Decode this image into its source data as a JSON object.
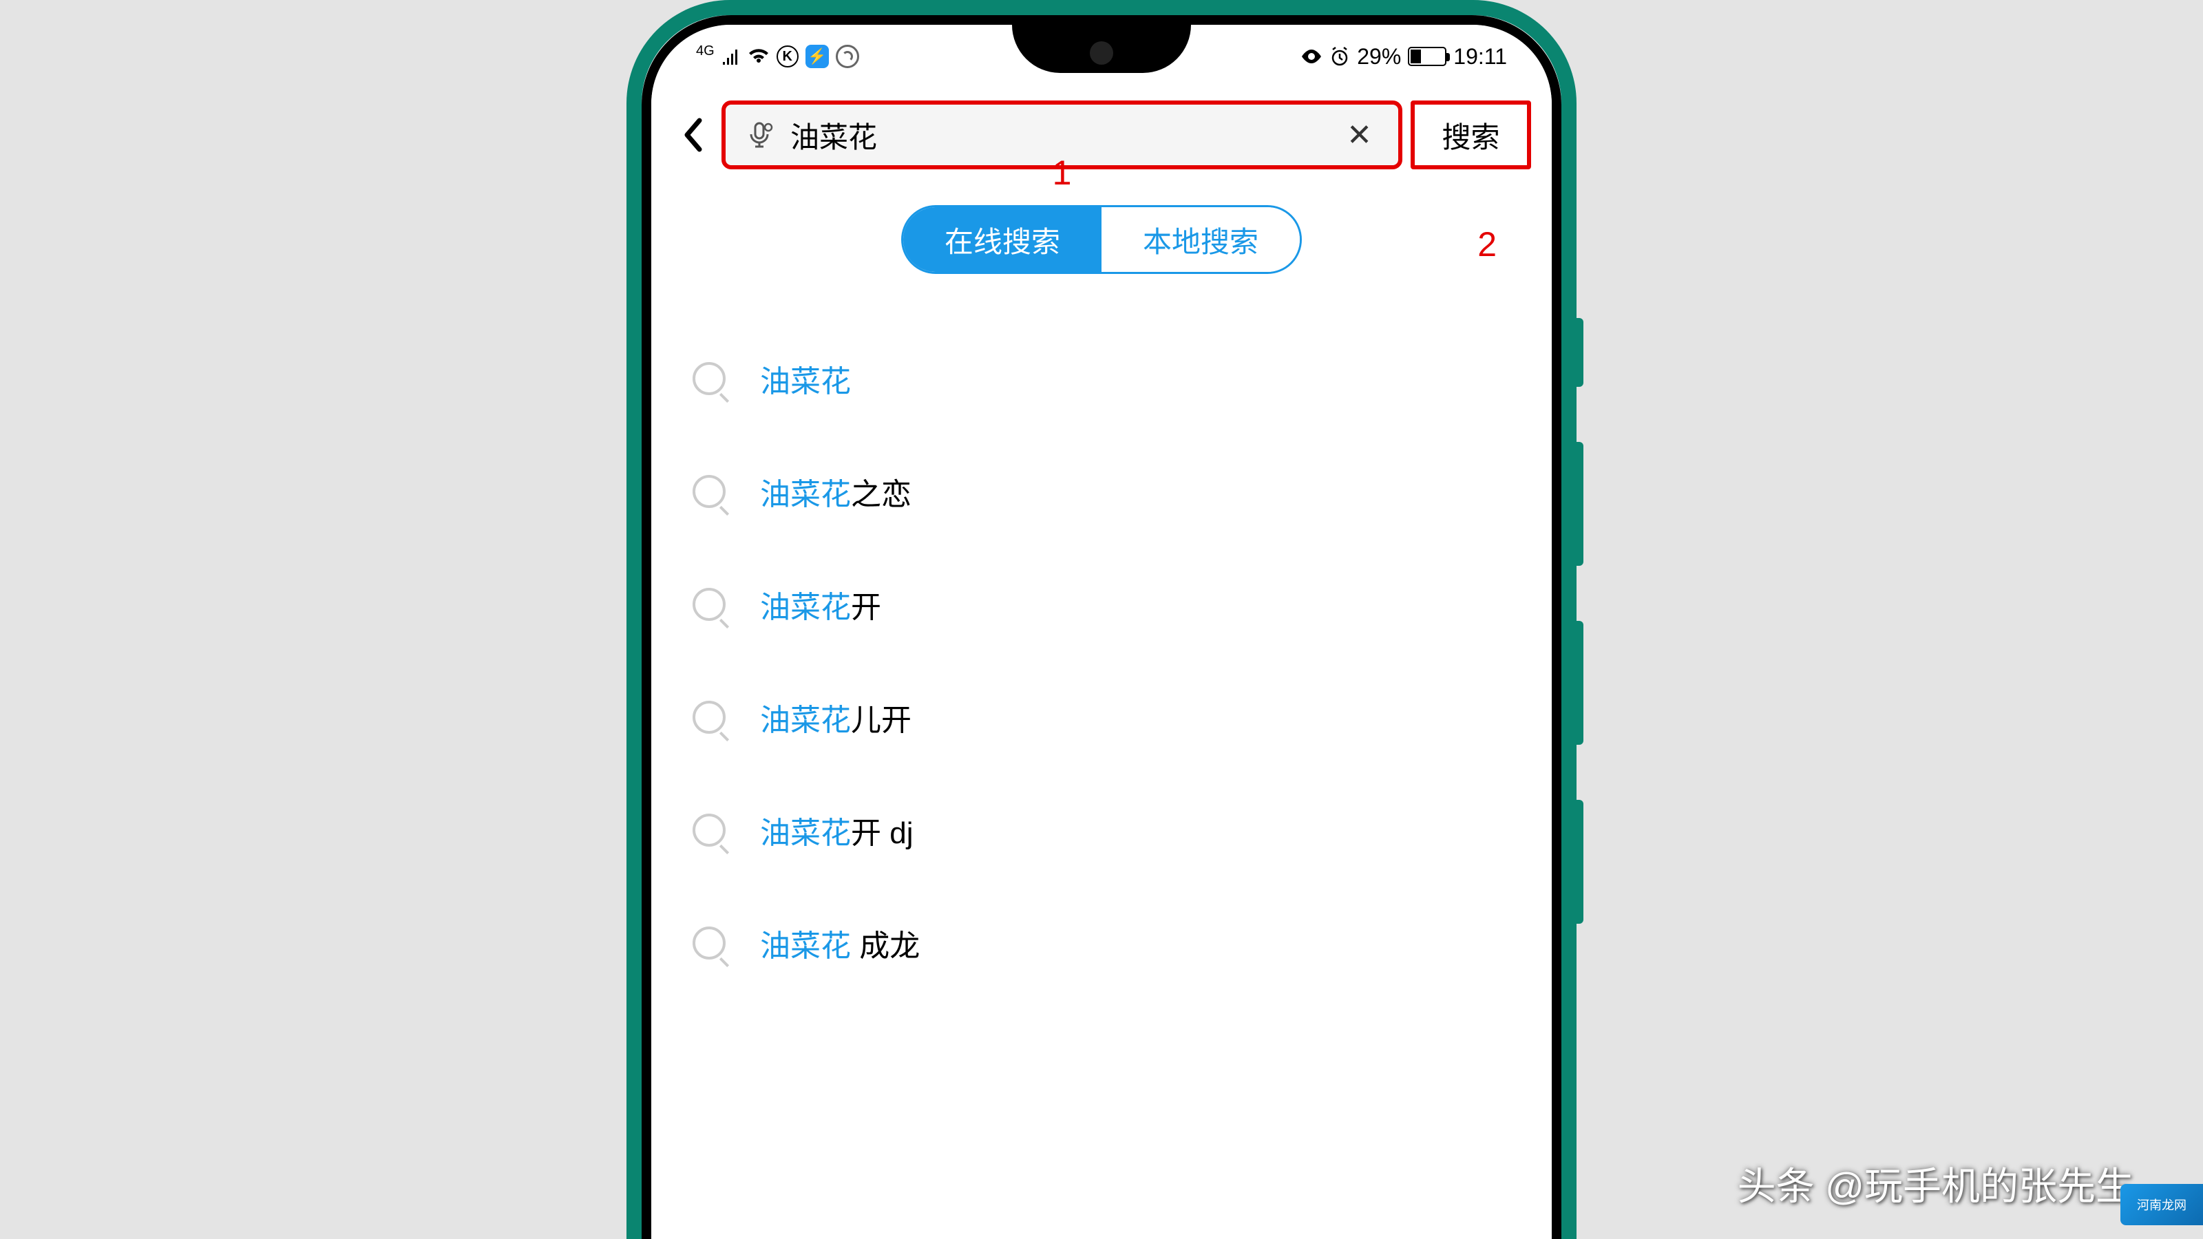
{
  "status_bar": {
    "signal_label": "4G",
    "battery_percent": "29%",
    "time": "19:11"
  },
  "search": {
    "query": "油菜花",
    "button_label": "搜索"
  },
  "annotations": {
    "label_1": "1",
    "label_2": "2"
  },
  "toggle": {
    "online": "在线搜索",
    "local": "本地搜索"
  },
  "suggestions": [
    {
      "highlight": "油菜花",
      "rest": ""
    },
    {
      "highlight": "油菜花",
      "rest": "之恋"
    },
    {
      "highlight": "油菜花",
      "rest": "开"
    },
    {
      "highlight": "油菜花",
      "rest": "儿开"
    },
    {
      "highlight": "油菜花",
      "rest": "开 dj"
    },
    {
      "highlight": "油菜花",
      "rest": " 成龙"
    }
  ],
  "watermark": "头条 @玩手机的张先生",
  "watermark2": "河南龙网"
}
